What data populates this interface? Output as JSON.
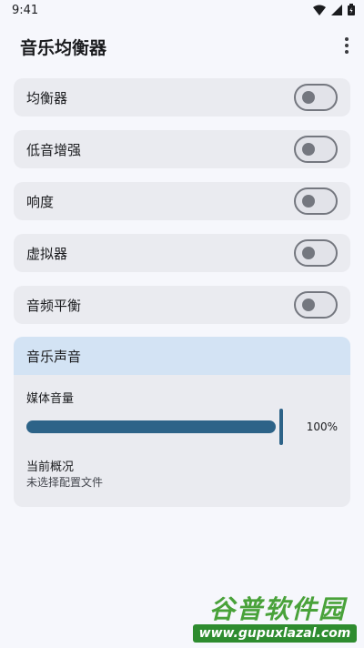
{
  "status_bar": {
    "time": "9:41"
  },
  "app_bar": {
    "title": "音乐均衡器",
    "menu_icon": "more-vert-icon"
  },
  "toggles": [
    {
      "label": "均衡器",
      "on": false
    },
    {
      "label": "低音增强",
      "on": false
    },
    {
      "label": "响度",
      "on": false
    },
    {
      "label": "虚拟器",
      "on": false
    },
    {
      "label": "音频平衡",
      "on": false
    }
  ],
  "music_sound": {
    "title": "音乐声音",
    "media_volume_label": "媒体音量",
    "media_volume_value": "100%",
    "media_volume_level": 1.0,
    "profile_label": "当前概况",
    "profile_value": "未选择配置文件"
  },
  "watermark": {
    "title": "谷普软件园",
    "url": "www.gupuxlazal.com"
  },
  "colors": {
    "accent": "#2d6388",
    "card_header": "#d3e3f4",
    "row_bg": "#eaebf0",
    "background": "#f6f7fc"
  }
}
